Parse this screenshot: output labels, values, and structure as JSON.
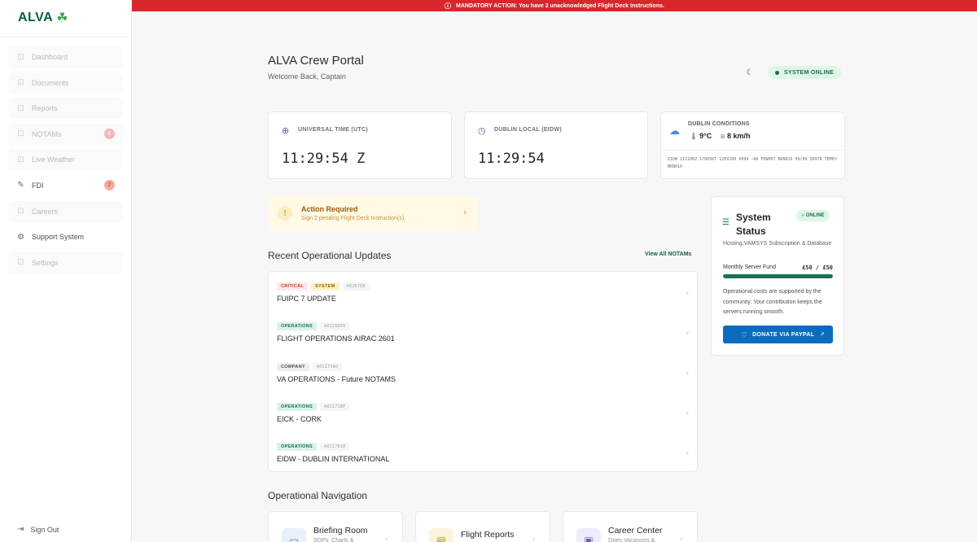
{
  "brand": {
    "name": "ALVA",
    "mark": "☘"
  },
  "sidebar": {
    "items": [
      {
        "label": "Dashboard",
        "icon": "lock-icon",
        "active": false
      },
      {
        "label": "Documents",
        "icon": "lock-icon",
        "active": false
      },
      {
        "label": "Reports",
        "icon": "lock-icon",
        "active": false
      },
      {
        "label": "NOTAMs",
        "icon": "lock-icon",
        "active": false,
        "badge": "6"
      },
      {
        "label": "Live Weather",
        "icon": "lock-icon",
        "active": false
      },
      {
        "label": "FDI",
        "icon": "edit-icon",
        "active": true,
        "badge": "2"
      },
      {
        "label": "Careers",
        "icon": "lock-icon",
        "active": false
      },
      {
        "label": "Support System",
        "icon": "gear-icon",
        "active": true
      },
      {
        "label": "Settings",
        "icon": "lock-icon",
        "active": false
      }
    ],
    "signout": "Sign Out"
  },
  "alert": {
    "text": "MANDATORY ACTION: You have 2 unacknowledged Flight Deck Instructions."
  },
  "header": {
    "title": "ALVA Crew Portal",
    "subtitle": "Welcome Back, Captain",
    "status": "SYSTEM ONLINE"
  },
  "clocks": {
    "utc": {
      "label": "UNIVERSAL TIME (UTC)",
      "value": "11:29:54 Z"
    },
    "local": {
      "label": "DUBLIN LOCAL (EIDW)",
      "value": "11:29:54"
    }
  },
  "conditions": {
    "label": "DUBLIN CONDITIONS",
    "temp": "9°C",
    "wind": "8 km/h",
    "metar": "EIDW 111100Z 17005KT 120V200 9999 -RA FEW007 BKN016 09/09 Q0978 TEMPO BKN010"
  },
  "action": {
    "title": "Action Required",
    "text": "Sign 2 pending Flight Deck Instruction(s)."
  },
  "updates": {
    "title": "Recent Operational Updates",
    "view_all": "View All NOTAMs",
    "items": [
      {
        "tags": [
          {
            "type": "critical",
            "label": "CRITICAL"
          },
          {
            "type": "system",
            "label": "SYSTEM"
          }
        ],
        "id": "A0207EB",
        "name": "FUIPC 7 UPDATE"
      },
      {
        "tags": [
          {
            "type": "operations",
            "label": "OPERATIONS"
          }
        ],
        "id": "A0125D65",
        "name": "FLIGHT OPERATIONS AIRAC 2601"
      },
      {
        "tags": [
          {
            "type": "company",
            "label": "COMPANY"
          }
        ],
        "id": "A01175AU",
        "name": "VA OPERATIONS - Future NOTAMS"
      },
      {
        "tags": [
          {
            "type": "operations",
            "label": "OPERATIONS"
          }
        ],
        "id": "A01171BF",
        "name": "EICK - CORK"
      },
      {
        "tags": [
          {
            "type": "operations",
            "label": "OPERATIONS"
          }
        ],
        "id": "A0117018",
        "name": "EIDW - DUBLIN INTERNATIONAL"
      }
    ]
  },
  "system_status": {
    "title": "System Status",
    "pill": "ONLINE",
    "desc": "Hosting,VAMSYS Subscription & Database",
    "fund_label": "Monthly Server Fund",
    "fund_value": "£50 / £50",
    "fund_fraction": 1.0,
    "note": "Operational costs are supported by the community. Your contribution keeps the servers running smooth.",
    "donate": "DONATE VIA PAYPAL"
  },
  "opnav": {
    "title": "Operational Navigation",
    "cards": [
      {
        "title": "Briefing Room",
        "sub": "SOPs, Charts &",
        "icon": "folder-icon",
        "color": "#3d7bd6",
        "bg": "#e7f0fc"
      },
      {
        "title": "Flight Reports",
        "sub": "",
        "icon": "clipboard-icon",
        "color": "#c58a15",
        "bg": "#fdf3dc"
      },
      {
        "title": "Career Center",
        "sub": "Open Vacancies &",
        "icon": "briefcase-icon",
        "color": "#6a5bc4",
        "bg": "#eeebfa"
      }
    ]
  },
  "colors": {
    "brand": "#0b5d46",
    "alert": "#d9262b",
    "accent": "#1b6f58",
    "paypal": "#0b6cbf"
  }
}
